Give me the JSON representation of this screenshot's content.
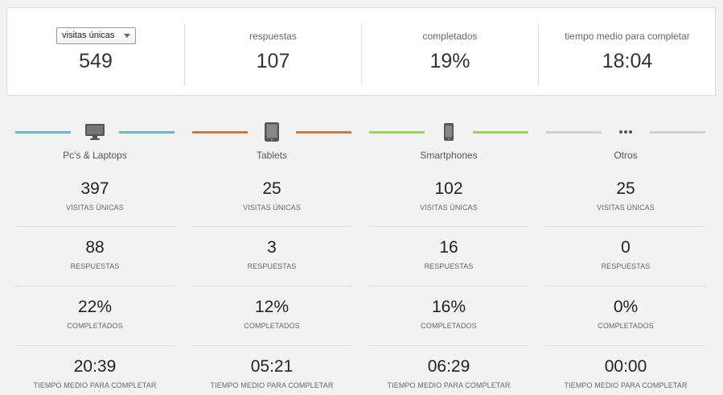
{
  "summary": {
    "select_value": "visitas únicas",
    "visits": "549",
    "responses_label": "respuestas",
    "responses": "107",
    "completed_label": "completados",
    "completed": "19%",
    "avg_time_label": "tiempo medio para completar",
    "avg_time": "18:04"
  },
  "labels": {
    "visits": "VISITAS ÚNICAS",
    "responses": "RESPUESTAS",
    "completed": "COMPLETADOS",
    "avg_time": "TIEMPO MEDIO PARA COMPLETAR"
  },
  "devices": [
    {
      "name": "Pc's & Laptops",
      "icon": "desktop-icon",
      "color": "#4fc1d9",
      "visits": "397",
      "responses": "88",
      "completed": "22%",
      "avg_time": "20:39"
    },
    {
      "name": "Tablets",
      "icon": "tablet-icon",
      "color": "#e8731f",
      "visits": "25",
      "responses": "3",
      "completed": "12%",
      "avg_time": "05:21"
    },
    {
      "name": "Smartphones",
      "icon": "smartphone-icon",
      "color": "#9fd82f",
      "visits": "102",
      "responses": "16",
      "completed": "16%",
      "avg_time": "06:29"
    },
    {
      "name": "Otros",
      "icon": "more-icon",
      "color": "#cfcfcf",
      "visits": "25",
      "responses": "0",
      "completed": "0%",
      "avg_time": "00:00"
    }
  ]
}
